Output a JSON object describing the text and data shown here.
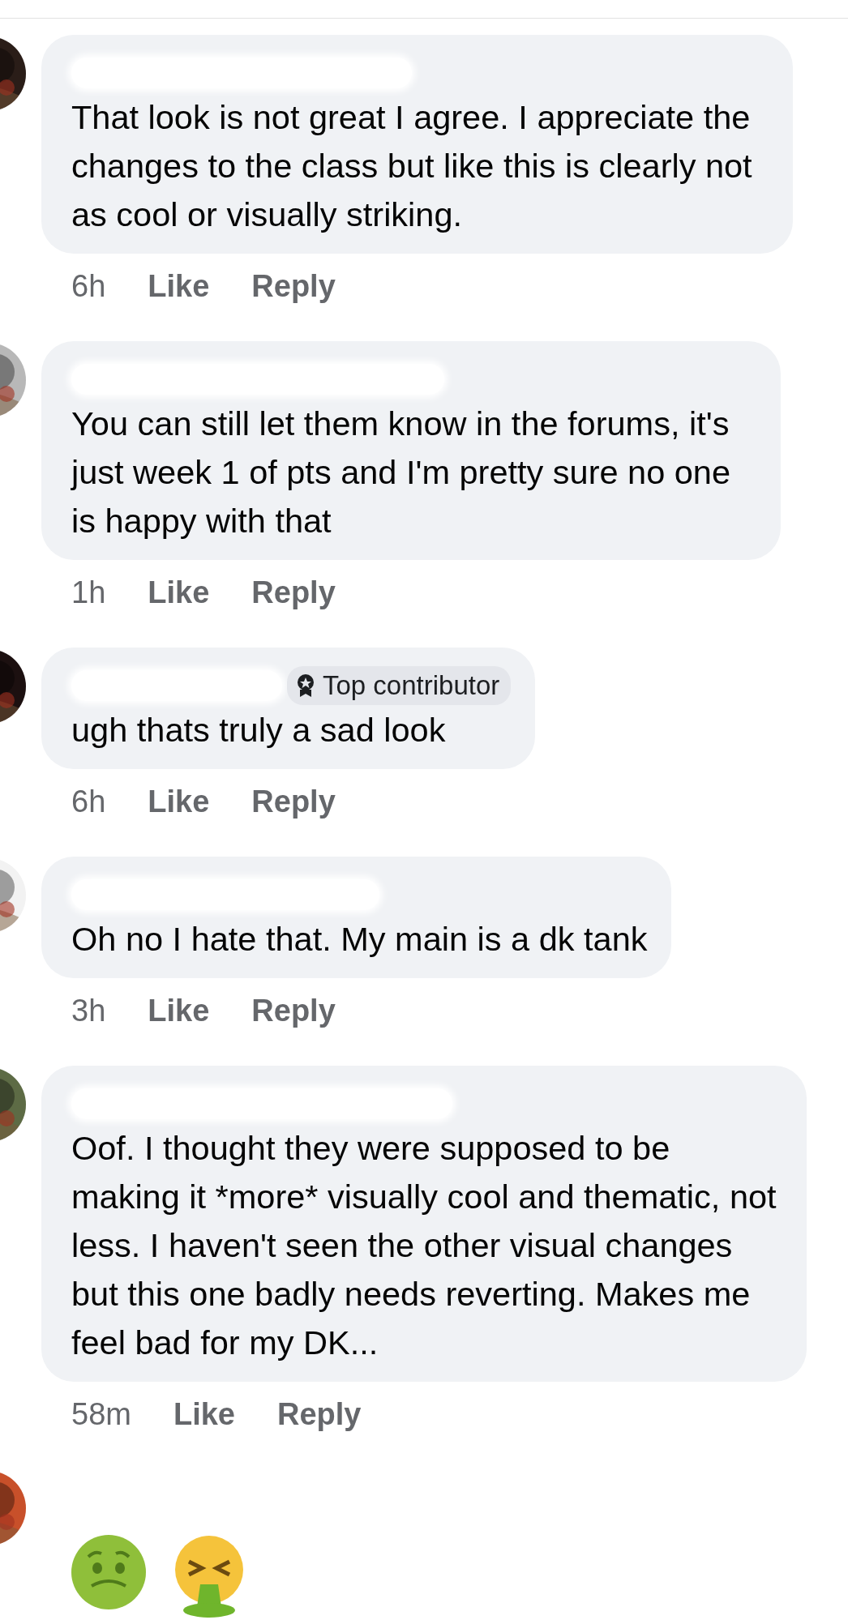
{
  "comments": [
    {
      "kind": "text",
      "text": "That look is not great I agree. I appreciate the changes to the class but like this is clearly not as cool or visually striking.",
      "time": "6h",
      "actions": [
        "Like",
        "Reply"
      ]
    },
    {
      "kind": "text",
      "text": "You can still let them know in the forums, it's just week 1 of pts and I'm pretty sure no one is happy with that",
      "time": "1h",
      "actions": [
        "Like",
        "Reply"
      ]
    },
    {
      "kind": "text",
      "badge": "Top contributor",
      "text": "ugh thats truly a sad look",
      "time": "6h",
      "actions": [
        "Like",
        "Reply"
      ]
    },
    {
      "kind": "text",
      "text": "Oh no I hate that. My main is a dk tank",
      "time": "3h",
      "actions": [
        "Like",
        "Reply"
      ]
    },
    {
      "kind": "text",
      "text": "Oof. I thought they were supposed to be making it *more* visually cool and thematic, not less. I haven't seen the other visual changes but this one badly needs reverting. Makes me feel bad for my DK...",
      "time": "58m",
      "actions": [
        "Like",
        "Reply"
      ]
    },
    {
      "kind": "emoji",
      "emojis": [
        {
          "kind": "nauseated"
        },
        {
          "kind": "vomiting"
        }
      ]
    }
  ]
}
